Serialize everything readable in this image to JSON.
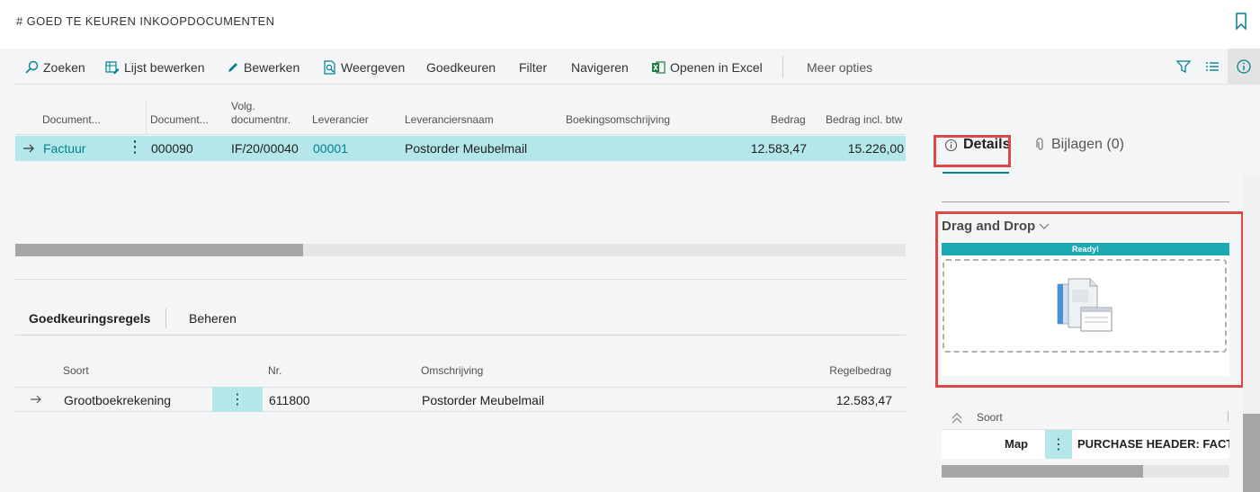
{
  "page": {
    "title": "# GOED TE KEUREN INKOOPDOCUMENTEN"
  },
  "actions": {
    "search": "Zoeken",
    "edit_list": "Lijst bewerken",
    "edit": "Bewerken",
    "view": "Weergeven",
    "approve": "Goedkeuren",
    "filter": "Filter",
    "navigate": "Navigeren",
    "open_excel": "Openen in Excel",
    "more": "Meer opties"
  },
  "grid": {
    "headers": [
      "Document...",
      "Document...",
      "Volg. documentnr.",
      "Leverancier",
      "Leveranciersnaam",
      "Boekingsomschrijving",
      "Bedrag",
      "Bedrag incl. btw"
    ],
    "header_volg_1": "Volg.",
    "header_volg_2": "documentnr.",
    "rows": [
      {
        "doc_type": "Factuur",
        "doc_no": "000090",
        "volg_no": "IF/20/00040",
        "vendor": "00001",
        "vendor_name": "Postorder Meubelmail",
        "description": "",
        "amount": "12.583,47",
        "amount_incl": "15.226,00"
      }
    ]
  },
  "subpage": {
    "tab_lines": "Goedkeuringsregels",
    "tab_manage": "Beheren",
    "headers": [
      "Soort",
      "Nr.",
      "Omschrijving",
      "Regelbedrag"
    ],
    "rows": [
      {
        "type": "Grootboekrekening",
        "no": "611800",
        "description": "Postorder Meubelmail",
        "amount": "12.583,47"
      }
    ]
  },
  "factbox": {
    "tab_details": "Details",
    "tab_attachments": "Bijlagen (0)",
    "dragdrop_title": "Drag and Drop",
    "ready": "Ready!",
    "list_header": "Soort",
    "row_label": "Map",
    "row_value": "PURCHASE HEADER: FACT"
  },
  "colors": {
    "accent": "#00838f",
    "selected_row": "#b3e7ea",
    "highlight": "#d94949",
    "ready_bar": "#1ba9b4"
  }
}
